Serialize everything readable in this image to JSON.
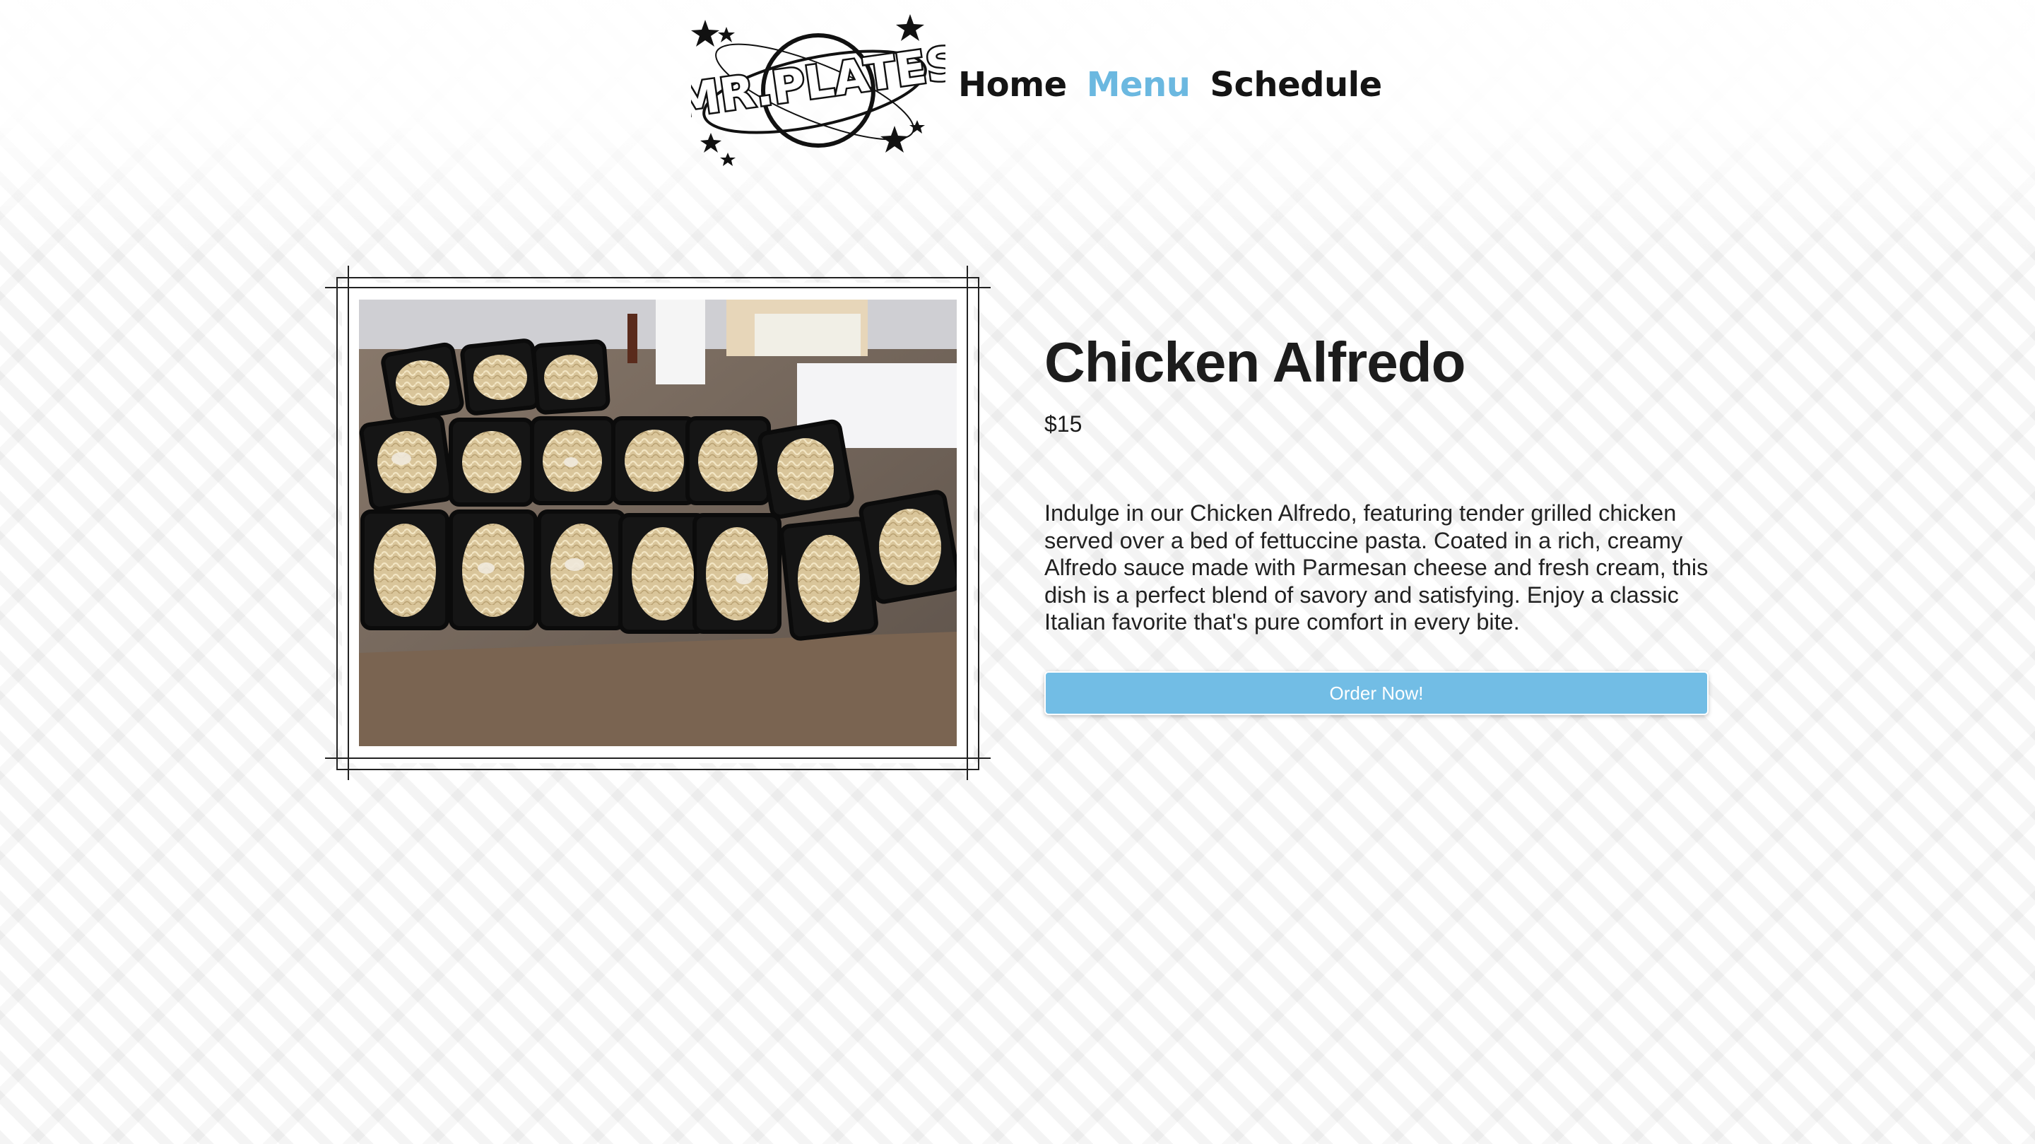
{
  "brand": {
    "logo_text": "MR.PLATES"
  },
  "nav": {
    "items": [
      {
        "label": "Home",
        "active": false
      },
      {
        "label": "Menu",
        "active": true
      },
      {
        "label": "Schedule",
        "active": false
      }
    ],
    "active_color": "#6bb8e0"
  },
  "product": {
    "image_icon": "food-photo",
    "name": "Chicken Alfredo",
    "price": "$15",
    "description": "Indulge in our Chicken Alfredo, featuring tender grilled chicken served over a bed of fettuccine pasta. Coated in a rich, creamy Alfredo sauce made with Parmesan cheese and fresh cream, this dish is a perfect blend of savory and satisfying. Enjoy a classic Italian favorite that's pure comfort in every bite.",
    "order_label": "Order Now!"
  },
  "colors": {
    "button": "#72bde5",
    "text": "#1c1c1c"
  }
}
